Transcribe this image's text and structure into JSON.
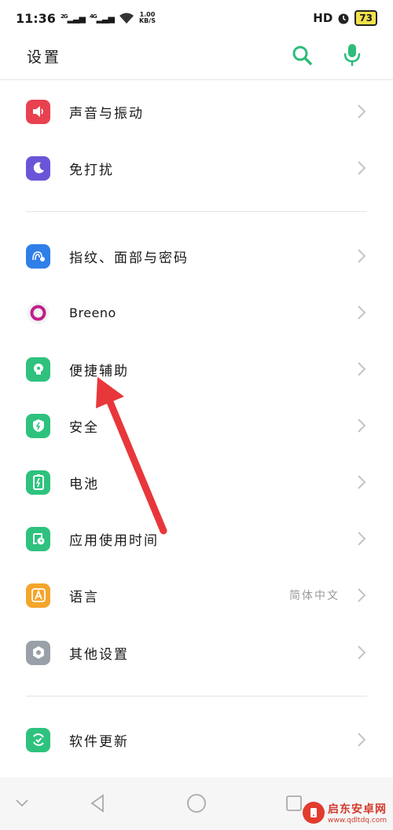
{
  "status_bar": {
    "time": "11:36",
    "sig1": "2G",
    "sig2": "4G",
    "net_speed": "1.00",
    "net_unit": "KB/S",
    "hd_label": "HD",
    "battery": "73"
  },
  "header": {
    "title": "设置",
    "search_icon": "search-icon",
    "mic_icon": "microphone-icon",
    "accent_color": "#2ebc7a"
  },
  "items": [
    {
      "label": "声音与振动",
      "icon": "speaker-icon",
      "color": "#e8414f"
    },
    {
      "label": "免打扰",
      "icon": "moon-icon",
      "color": "#6a55d8"
    },
    {
      "label": "指纹、面部与密码",
      "icon": "fingerprint-icon",
      "color": "#2f7fe8"
    },
    {
      "label": "Breeno",
      "icon": "breeno-icon",
      "color": "#c01f8a"
    },
    {
      "label": "便捷辅助",
      "icon": "accessibility-icon",
      "color": "#2ec27e"
    },
    {
      "label": "安全",
      "icon": "shield-icon",
      "color": "#2ec27e"
    },
    {
      "label": "电池",
      "icon": "battery-icon",
      "color": "#2ec27e"
    },
    {
      "label": "应用使用时间",
      "icon": "app-time-icon",
      "color": "#2ec27e"
    },
    {
      "label": "语言",
      "icon": "language-icon",
      "color": "#f4a52b",
      "value": "简体中文"
    },
    {
      "label": "其他设置",
      "icon": "gear-icon",
      "color": "#9aa0a8"
    },
    {
      "label": "软件更新",
      "icon": "update-icon",
      "color": "#2ec27e"
    }
  ],
  "nav_bar": {
    "icons": [
      "chevron-down-icon",
      "back-icon",
      "home-icon",
      "recents-icon"
    ]
  },
  "watermark": {
    "name": "启东安卓网",
    "url": "www.qdltdq.com"
  }
}
